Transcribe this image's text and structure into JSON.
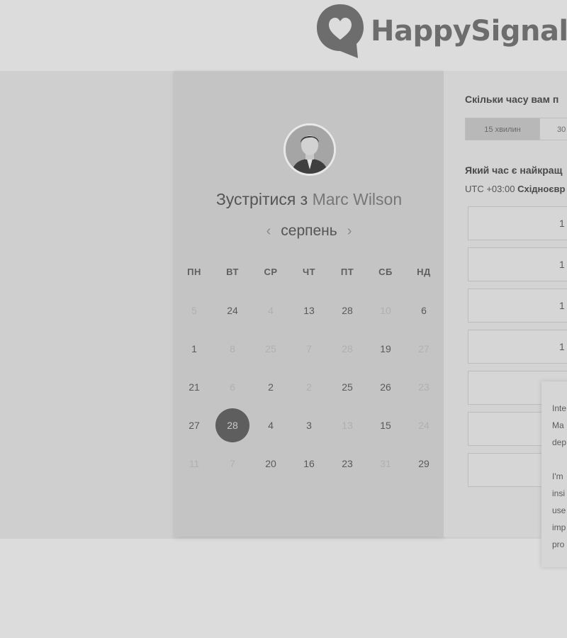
{
  "brand": {
    "name": "HappySignals"
  },
  "meeting": {
    "title_prefix": "Зустрітися з",
    "host": "Marc Wilson",
    "month": "серпень",
    "prev_arrow": "‹",
    "next_arrow": "›"
  },
  "calendar": {
    "weekdays": [
      "ПН",
      "ВТ",
      "СР",
      "ЧТ",
      "ПТ",
      "СБ",
      "НД"
    ],
    "weeks": [
      [
        {
          "d": "5",
          "dim": true
        },
        {
          "d": "24"
        },
        {
          "d": "4",
          "dim": true
        },
        {
          "d": "13"
        },
        {
          "d": "28"
        },
        {
          "d": "10",
          "dim": true
        },
        {
          "d": "6"
        }
      ],
      [
        {
          "d": "1"
        },
        {
          "d": "8",
          "dim": true
        },
        {
          "d": "25",
          "dim": true
        },
        {
          "d": "7",
          "dim": true
        },
        {
          "d": "28",
          "dim": true
        },
        {
          "d": "19"
        },
        {
          "d": "27",
          "dim": true
        }
      ],
      [
        {
          "d": "21"
        },
        {
          "d": "6",
          "dim": true
        },
        {
          "d": "2"
        },
        {
          "d": "2",
          "dim": true
        },
        {
          "d": "25"
        },
        {
          "d": "26"
        },
        {
          "d": "23",
          "dim": true
        }
      ],
      [
        {
          "d": "27"
        },
        {
          "d": "28",
          "selected": true
        },
        {
          "d": "4"
        },
        {
          "d": "3"
        },
        {
          "d": "13",
          "dim": true
        },
        {
          "d": "15"
        },
        {
          "d": "24",
          "dim": true
        }
      ],
      [
        {
          "d": "11",
          "dim": true
        },
        {
          "d": "7",
          "dim": true
        },
        {
          "d": "20"
        },
        {
          "d": "16"
        },
        {
          "d": "23"
        },
        {
          "d": "31",
          "dim": true
        },
        {
          "d": "29"
        }
      ]
    ]
  },
  "booking": {
    "duration_question": "Скільки часу вам п",
    "durations": [
      "15 хвилин",
      "30"
    ],
    "time_question": "Який час є найкращ",
    "timezone_prefix": "UTC +03:00",
    "timezone_name": "Східноєвр",
    "slots": [
      "1",
      "1",
      "1",
      "1",
      "",
      "",
      ""
    ]
  },
  "popup": {
    "lines": [
      "Inte",
      "Ma",
      "dep",
      "",
      "I'm",
      "insi",
      "use",
      "imp",
      "pro"
    ]
  },
  "colors": {
    "background": "#dcdcdc",
    "panel": "#c4c4c4",
    "selected": "#5e5e5e"
  }
}
